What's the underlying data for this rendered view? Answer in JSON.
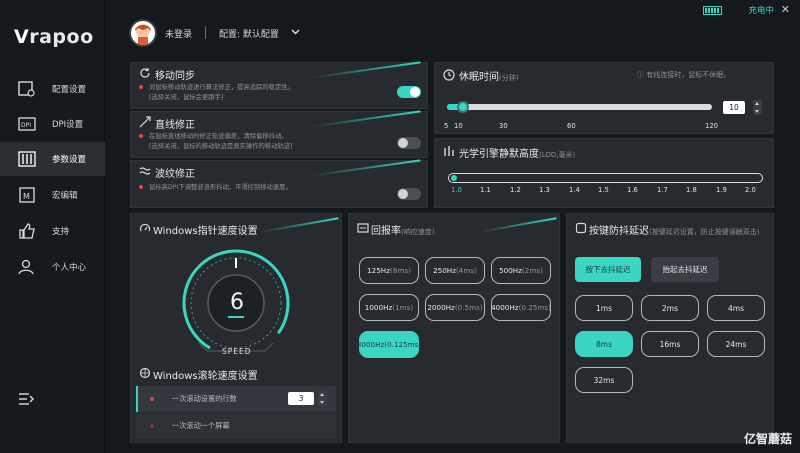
{
  "brand": {
    "logo_v": "V",
    "logo_text": "rapoo"
  },
  "sidebar": {
    "items": [
      {
        "label": "配置设置",
        "icon": "profile-config-icon"
      },
      {
        "label": "DPI设置",
        "icon": "dpi-icon"
      },
      {
        "label": "参数设置",
        "icon": "sliders-icon"
      },
      {
        "label": "宏编辑",
        "icon": "macro-icon"
      },
      {
        "label": "支持",
        "icon": "thumbs-up-icon"
      },
      {
        "label": "个人中心",
        "icon": "user-icon"
      }
    ],
    "active": 2,
    "menu_icon": "menu-collapse-icon"
  },
  "header": {
    "user": "未登录",
    "config": "配置: 默认配置",
    "charge": "充电中",
    "battery_icon": "battery-icon",
    "close": "✕"
  },
  "motion_sync": {
    "title": "移动同步",
    "lines": [
      "对鼠标移动轨迹进行算法修正，提高追踪的稳定性。",
      "[选择关闭，鼠标会更跟手]"
    ],
    "enabled": true
  },
  "angle_snap": {
    "title": "直线修正",
    "lines": [
      "在鼠标直线移动时修正轨迹偏差，清除偏移抖动。",
      "[选择关闭，鼠标的移动轨迹是真实操作的移动轨迹]"
    ],
    "enabled": false
  },
  "ripple": {
    "title": "波纹修正",
    "lines": [
      "鼠标高DPI下调整波浪形抖动，平滑控制移动速度。"
    ],
    "enabled": false
  },
  "sleep": {
    "title": "休眠时间",
    "unit": "(分钟)",
    "note": "有线连接时，鼠标不休眠。",
    "value": "10",
    "ticks": [
      "5",
      "10",
      "30",
      "60",
      "120"
    ]
  },
  "lod": {
    "title": "光学引擎静默高度",
    "unit": "(LOD,毫米)",
    "ticks": [
      "1.0",
      "1.1",
      "1.2",
      "1.3",
      "1.4",
      "1.5",
      "1.6",
      "1.7",
      "1.8",
      "1.9",
      "2.0"
    ],
    "value": "1.0"
  },
  "pointer": {
    "title": "Windows指针速度设置",
    "value": "6",
    "label": "SPEED"
  },
  "scroll": {
    "title": "Windows滚轮速度设置",
    "row1": "一次滚动设置的行数",
    "row1_value": "3",
    "row2": "一次滚动一个屏幕"
  },
  "polling": {
    "title": "回报率",
    "sub": "(响应速度)",
    "options": [
      {
        "hz": "125Hz",
        "ms": "(8ms)"
      },
      {
        "hz": "250Hz",
        "ms": "(4ms)"
      },
      {
        "hz": "500Hz",
        "ms": "(2ms)"
      },
      {
        "hz": "1000Hz",
        "ms": "(1ms)"
      },
      {
        "hz": "2000Hz",
        "ms": "(0.5ms)"
      },
      {
        "hz": "4000Hz",
        "ms": "(0.25ms)"
      },
      {
        "hz": "8000Hz",
        "ms": "(0.125ms)"
      }
    ],
    "selected": 6
  },
  "debounce": {
    "title": "按键防抖延迟",
    "sub": "(按键延迟设置，防止按键误触双击)",
    "press": "按下去抖延迟",
    "release": "抬起去抖延迟",
    "options": [
      "1ms",
      "2ms",
      "4ms",
      "8ms",
      "16ms",
      "24ms",
      "32ms"
    ],
    "selected": 3
  },
  "watermark": "亿智蘑菇"
}
